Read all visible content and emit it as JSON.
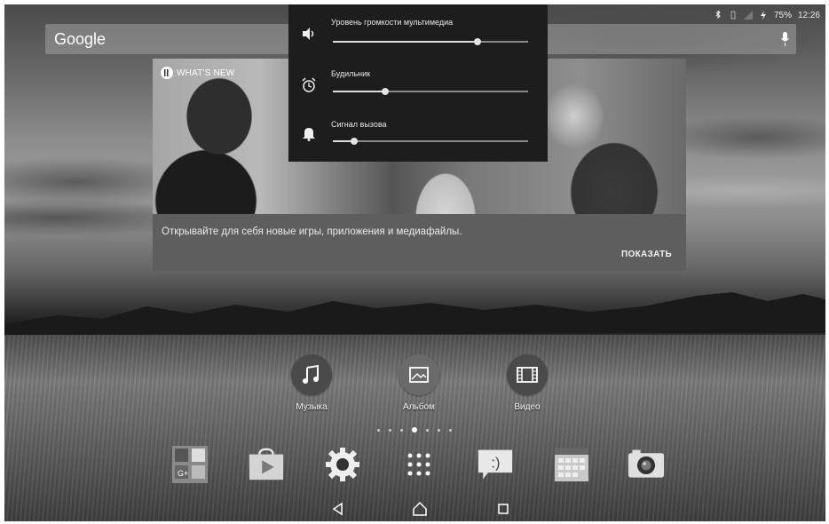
{
  "status_bar": {
    "time": "12:26",
    "battery": "75%",
    "icons": [
      "bluetooth-icon",
      "vibrate-icon",
      "no-signal-icon",
      "charging-icon"
    ]
  },
  "search": {
    "brand": "Google",
    "mic_icon": "mic-icon"
  },
  "card": {
    "tag": "WHAT'S NEW",
    "text": "Открывайте для себя новые игры, приложения и медиафайлы.",
    "action": "ПОКАЗАТЬ"
  },
  "volume": {
    "rows": [
      {
        "label": "Уровень громкости мультимедиа",
        "icon": "speaker-icon",
        "level": 0.74
      },
      {
        "label": "Будильник",
        "icon": "alarm-clock-icon",
        "level": 0.27
      },
      {
        "label": "Сигнал вызова",
        "icon": "bell-icon",
        "level": 0.11
      }
    ]
  },
  "apps": [
    {
      "label": "Музыка",
      "icon": "music-note-icon"
    },
    {
      "label": "Альбом",
      "icon": "album-icon"
    },
    {
      "label": "Видео",
      "icon": "film-icon"
    }
  ],
  "pager": {
    "pages": 7,
    "active": 3
  },
  "dock": [
    "google-folder-icon",
    "play-store-icon",
    "settings-gear-icon",
    "app-drawer-icon",
    "messaging-icon",
    "calendar-icon",
    "camera-icon"
  ],
  "nav": [
    "back-icon",
    "home-icon",
    "recents-icon"
  ],
  "colors": {
    "panel": "#1d1d1d",
    "card": "#5e5e5e",
    "text": "#ffffff"
  }
}
